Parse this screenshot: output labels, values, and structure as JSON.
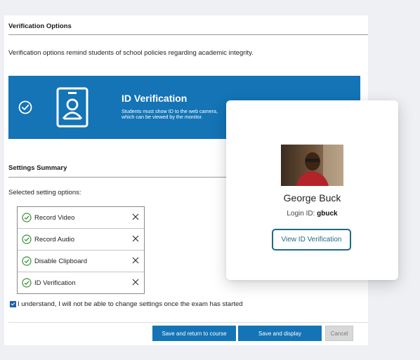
{
  "verification": {
    "title": "Verification Options",
    "description": "Verification options remind students of school policies regarding academic integrity.",
    "banner": {
      "title": "ID Verification",
      "text": "Students must show ID to the web camera, which can be viewed by the monitor."
    }
  },
  "settings": {
    "title": "Settings Summary",
    "selected_label": "Selected setting options:",
    "options": [
      {
        "label": "Record Video"
      },
      {
        "label": "Record Audio"
      },
      {
        "label": "Disable Clipboard"
      },
      {
        "label": "ID Verification"
      }
    ]
  },
  "acknowledge": {
    "label": "I understand, I will not be able to change settings once the exam has started",
    "checked": true
  },
  "buttons": {
    "save_return": "Save and return to course",
    "save_display": "Save and display",
    "cancel": "Cancel"
  },
  "card": {
    "name": "George Buck",
    "login_label": "Login ID:",
    "login_value": "gbuck",
    "button": "View ID Verification"
  },
  "colors": {
    "accent": "#1474b6",
    "card_button": "#1d6b86",
    "check": "#3a8f3a"
  },
  "icons": {
    "banner_check": "check-circle-icon",
    "banner_badge": "id-badge-icon",
    "option_check": "check-circle-icon",
    "option_remove": "close-icon"
  }
}
